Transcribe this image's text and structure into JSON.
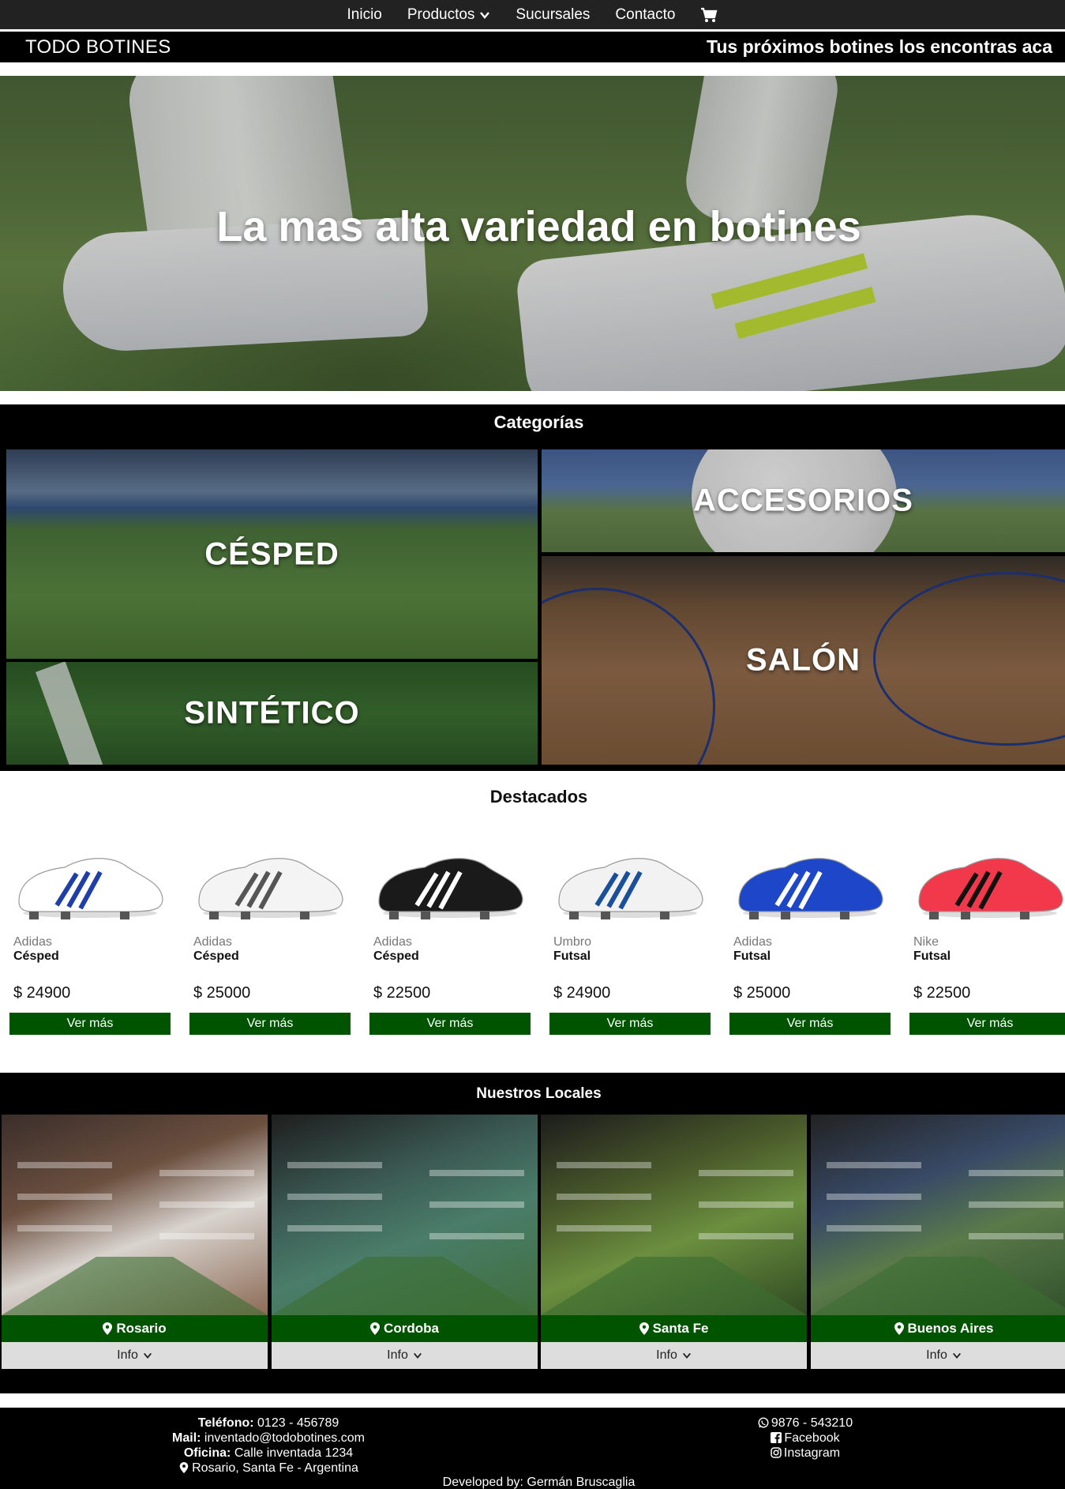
{
  "nav": {
    "items": [
      {
        "label": "Inicio"
      },
      {
        "label": "Productos",
        "icon": "chevron-down-icon"
      },
      {
        "label": "Sucursales"
      },
      {
        "label": "Contacto"
      }
    ],
    "cart_icon": "cart-icon"
  },
  "brandbar": {
    "brand": "TODO BOTINES",
    "tagline": "Tus próximos botines los encontras aca"
  },
  "hero": {
    "headline": "La mas alta variedad en botines"
  },
  "categories": {
    "title": "Categorías",
    "items": [
      {
        "label": "CÉSPED"
      },
      {
        "label": "ACCESORIOS"
      },
      {
        "label": "SALÓN"
      },
      {
        "label": "SINTÉTICO"
      }
    ]
  },
  "featured": {
    "title": "Destacados",
    "button_label": "Ver más",
    "products": [
      {
        "brand": "Adidas",
        "category": "Césped",
        "price": "$ 24900",
        "color": "#ffffff",
        "accent": "#1f3fa8"
      },
      {
        "brand": "Adidas",
        "category": "Césped",
        "price": "$ 25000",
        "color": "#f4f4f4",
        "accent": "#555555"
      },
      {
        "brand": "Adidas",
        "category": "Césped",
        "price": "$ 22500",
        "color": "#1a1a1a",
        "accent": "#ffffff"
      },
      {
        "brand": "Umbro",
        "category": "Futsal",
        "price": "$ 24900",
        "color": "#f2f2f2",
        "accent": "#1a4f9a"
      },
      {
        "brand": "Adidas",
        "category": "Futsal",
        "price": "$ 25000",
        "color": "#1d46c8",
        "accent": "#ffffff"
      },
      {
        "brand": "Nike",
        "category": "Futsal",
        "price": "$ 22500",
        "color": "#f2394c",
        "accent": "#111111"
      }
    ]
  },
  "stores": {
    "title": "Nuestros Locales",
    "info_label": "Info",
    "items": [
      {
        "name": "Rosario"
      },
      {
        "name": "Cordoba"
      },
      {
        "name": "Santa Fe"
      },
      {
        "name": "Buenos Aires"
      }
    ]
  },
  "footer": {
    "phone_label": "Teléfono:",
    "phone": "0123 - 456789",
    "mail_label": "Mail:",
    "mail": "inventado@todobotines.com",
    "office_label": "Oficina:",
    "office": "Calle inventada 1234",
    "city": "Rosario, Santa Fe - Argentina",
    "whatsapp": "9876 - 543210",
    "facebook": "Facebook",
    "instagram": "Instagram",
    "developed": "Developed by: Germán Bruscaglia"
  },
  "colors": {
    "accent_green": "#005400",
    "nav_bg": "#222222",
    "section_bg": "#000000"
  }
}
